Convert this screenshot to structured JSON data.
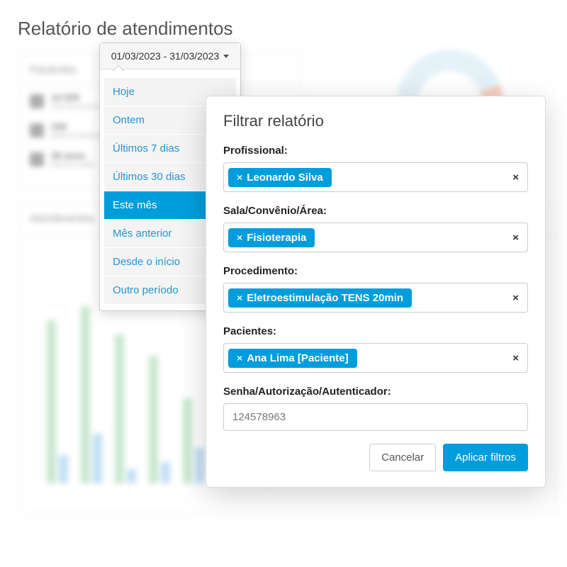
{
  "page": {
    "title": "Relatório de atendimentos"
  },
  "background": {
    "panel1_title": "Pacientes",
    "stat1_num": "14 529",
    "stat1_lbl": "Total de pacientes",
    "stat2_num": "106",
    "stat2_lbl": "Média de atendimentos",
    "stat3_num": "39 anos",
    "stat3_lbl": "Média de idade",
    "panel2_title": "Atendimentos"
  },
  "date_picker": {
    "value": "01/03/2023 - 31/03/2023",
    "options": [
      {
        "label": "Hoje",
        "active": false
      },
      {
        "label": "Ontem",
        "active": false
      },
      {
        "label": "Últimos 7 dias",
        "active": false
      },
      {
        "label": "Últimos 30 dias",
        "active": false
      },
      {
        "label": "Este mês",
        "active": true
      },
      {
        "label": "Mês anterior",
        "active": false
      },
      {
        "label": "Desde o início",
        "active": false
      },
      {
        "label": "Outro período",
        "active": false
      }
    ]
  },
  "filter_modal": {
    "title": "Filtrar relatório",
    "fields": {
      "professional": {
        "label": "Profissional:",
        "tag": "Leonardo Silva"
      },
      "room": {
        "label": "Sala/Convênio/Área:",
        "tag": "Fisioterapia"
      },
      "procedure": {
        "label": "Procedimento:",
        "tag": "Eletroestimulação TENS 20min"
      },
      "patients": {
        "label": "Pacientes:",
        "tag": "Ana Lima [Paciente]"
      },
      "auth": {
        "label": "Senha/Autorização/Autenticador:",
        "value": "124578963"
      }
    },
    "buttons": {
      "cancel": "Cancelar",
      "apply": "Aplicar filtros"
    }
  }
}
